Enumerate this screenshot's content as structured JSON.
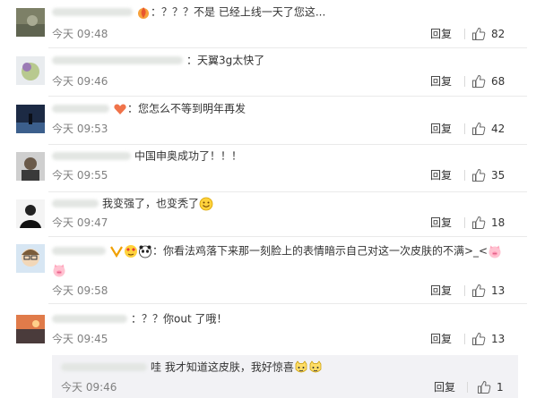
{
  "ui": {
    "reply_label": "回复"
  },
  "comments": [
    {
      "content": "：？？？不是  已经上线一天了您这...",
      "time": "今天 09:48",
      "likes": "82"
    },
    {
      "content": "：天翼3g太快了",
      "time": "今天 09:46",
      "likes": "68"
    },
    {
      "content": "：您怎么不等到明年再发",
      "time": "今天 09:53",
      "likes": "42"
    },
    {
      "content": "中国申奥成功了！！！",
      "time": "今天 09:55",
      "likes": "35"
    },
    {
      "content": "我变强了，也变秃了",
      "time": "今天 09:47",
      "likes": "18"
    },
    {
      "content_line1": "：你看法鸡落下来那一刻脸上的表情暗示自己对这一次皮肤的不满>_<",
      "time": "今天 09:58",
      "likes": "13"
    },
    {
      "content": "：？？你out 了哦！",
      "time": "今天 09:45",
      "likes": "13"
    }
  ],
  "subreply": {
    "content": "哇 我才知道这皮肤，我好惊喜",
    "time": "今天 09:46",
    "likes": "1"
  },
  "colors": {
    "time": "#808080",
    "text": "#333333",
    "divider": "#eaeaea",
    "subreply_bg": "#f2f2f5"
  }
}
